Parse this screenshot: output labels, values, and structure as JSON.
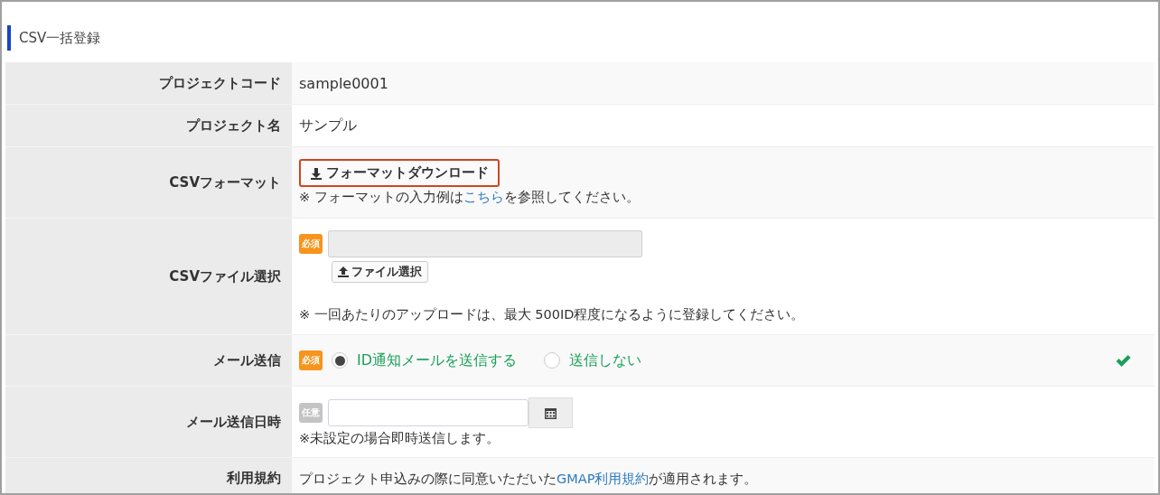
{
  "section": {
    "title": "CSV一括登録"
  },
  "rows": [
    {
      "kind": "text",
      "label": "プロジェクトコード",
      "value": "sample0001"
    },
    {
      "kind": "text",
      "label": "プロジェクト名",
      "value": "サンプル"
    },
    {
      "kind": "download",
      "label": "CSVフォーマット",
      "button": "フォーマットダウンロード",
      "highlighted": true,
      "note": {
        "before": "※ フォーマットの入力例は",
        "link": "こちら",
        "after": "を参照してください。"
      }
    },
    {
      "kind": "file",
      "label": "CSVファイル選択",
      "badge": {
        "text": "必須",
        "kind": "required"
      },
      "button": "ファイル選択",
      "note": "※ 一回あたりのアップロードは、最大 500ID程度になるように登録してください。"
    },
    {
      "kind": "radio",
      "label": "メール送信",
      "badge": {
        "text": "必須",
        "kind": "required"
      },
      "valid": true,
      "options": [
        {
          "label": "ID通知メールを送信する",
          "selected": true
        },
        {
          "label": "送信しない",
          "selected": false
        }
      ]
    },
    {
      "kind": "date",
      "label": "メール送信日時",
      "badge": {
        "text": "任意",
        "kind": "optional"
      },
      "note": "※未設定の場合即時送信します。"
    },
    {
      "kind": "linktext",
      "label": "利用規約",
      "note": {
        "before": "プロジェクト申込みの際に同意いただいた",
        "link": "GMAP利用規約",
        "after": "が適用されます。"
      }
    }
  ]
}
